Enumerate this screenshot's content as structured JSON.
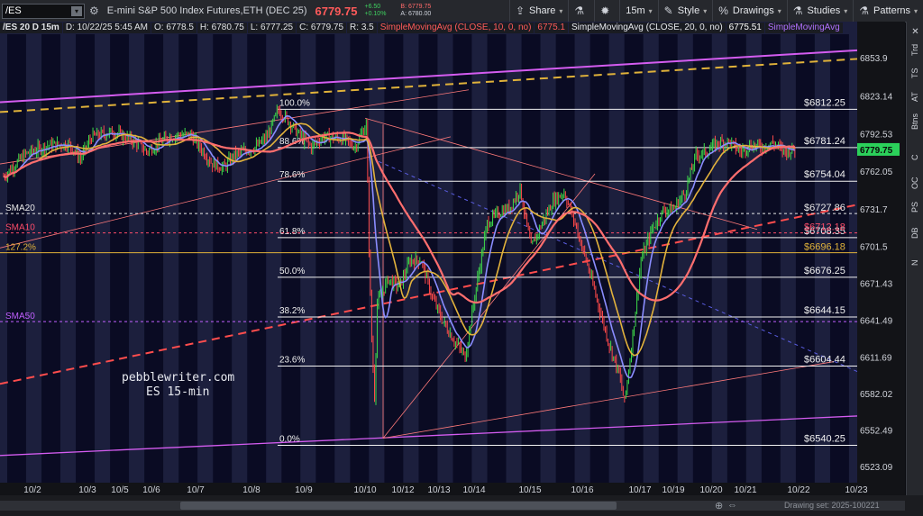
{
  "toolbar": {
    "symbol": "/ES",
    "description": "E-mini S&P 500 Index Futures,ETH (DEC 25)",
    "last_price": "6779.75",
    "change": "+6.50",
    "change_pct": "+0.10%",
    "bid": "B: 6779.75",
    "ask": "A: 6780.00",
    "share_label": "Share",
    "timeframe_label": "15m",
    "style_label": "Style",
    "drawings_label": "Drawings",
    "studies_label": "Studies",
    "patterns_label": "Patterns"
  },
  "header": {
    "title": "/ES 20 D 15m",
    "date": "D: 10/22/25 5:45 AM",
    "open": "O: 6778.5",
    "high": "H: 6780.75",
    "low": "L: 6777.25",
    "close": "C: 6779.75",
    "range": "R: 3.5",
    "sma10_label": "SimpleMovingAvg (CLOSE, 10, 0, no)",
    "sma10_value": "6775.1",
    "sma20_label": "SimpleMovingAvg (CLOSE, 20, 0, no)",
    "sma20_value": "6775.51",
    "sma50_label": "SimpleMovingAvg"
  },
  "sidebar": {
    "items": [
      "Trd",
      "TS",
      "AT",
      "Btns",
      "C",
      "OC",
      "PS",
      "DB",
      "N"
    ]
  },
  "watermark": {
    "line1": "pebblewriter.com",
    "line2": "ES 15-min"
  },
  "footer": {
    "drawing_set": "Drawing set: 2025-100221"
  },
  "chart_data": {
    "type": "candlestick",
    "title": "/ES 20 D 15m",
    "ylim": [
      6510,
      6873
    ],
    "y_ticks": [
      6853.9,
      6823.14,
      6792.53,
      6762.05,
      6731.7,
      6701.5,
      6671.43,
      6641.49,
      6611.69,
      6582.02,
      6552.49,
      6523.09
    ],
    "x_tick_labels": [
      "10/2",
      "10/3",
      "10/5",
      "10/6",
      "10/7",
      "10/8",
      "10/9",
      "10/10",
      "10/12",
      "10/13",
      "10/14",
      "10/15",
      "10/16",
      "10/17",
      "10/19",
      "10/20",
      "10/21",
      "10/22",
      "10/23"
    ],
    "last_price": 6779.75,
    "fib_levels": [
      {
        "label": "100.0%",
        "price": 6812.25,
        "price_label": "$6812.25"
      },
      {
        "label": "88.6%",
        "price": 6781.24,
        "price_label": "$6781.24"
      },
      {
        "label": "78.6%",
        "price": 6754.04,
        "price_label": "$6754.04"
      },
      {
        "label": "61.8%",
        "price": 6708.35,
        "price_label": "$6708.35"
      },
      {
        "label": "50.0%",
        "price": 6676.25,
        "price_label": "$6676.25"
      },
      {
        "label": "38.2%",
        "price": 6644.15,
        "price_label": "$6644.15"
      },
      {
        "label": "23.6%",
        "price": 6604.44,
        "price_label": "$6604.44"
      },
      {
        "label": "0.0%",
        "price": 6540.25,
        "price_label": "$6540.25"
      }
    ],
    "other_levels": [
      {
        "label": "SMA20",
        "price": 6727.86,
        "price_label": "$6727.86",
        "color": "#e8e8e8"
      },
      {
        "label": "SMA10",
        "price": 6712.18,
        "price_label": "$6712.18",
        "color": "#ff4d6a"
      },
      {
        "label": "127.2%",
        "price": 6696.18,
        "price_label": "$6696.18",
        "color": "#e0b23a"
      },
      {
        "label": "SMA50",
        "price": 6640.4,
        "price_label": "",
        "color": "#c060ff"
      }
    ],
    "price_path": [
      [
        0,
        6758
      ],
      [
        4,
        6776
      ],
      [
        8,
        6783
      ],
      [
        12,
        6784
      ],
      [
        14,
        6772
      ],
      [
        16,
        6790
      ],
      [
        20,
        6794
      ],
      [
        24,
        6786
      ],
      [
        26,
        6778
      ],
      [
        30,
        6790
      ],
      [
        34,
        6792
      ],
      [
        38,
        6768
      ],
      [
        40,
        6765
      ],
      [
        42,
        6775
      ],
      [
        46,
        6782
      ],
      [
        48,
        6790
      ],
      [
        50,
        6812
      ],
      [
        52,
        6802
      ],
      [
        54,
        6790
      ],
      [
        56,
        6782
      ],
      [
        58,
        6790
      ],
      [
        62,
        6788
      ],
      [
        64,
        6782
      ],
      [
        66,
        6800
      ],
      [
        66.5,
        6700
      ],
      [
        67,
        6625
      ],
      [
        67.5,
        6580
      ],
      [
        68,
        6655
      ],
      [
        70,
        6675
      ],
      [
        72,
        6668
      ],
      [
        74,
        6690
      ],
      [
        76,
        6690
      ],
      [
        78,
        6660
      ],
      [
        80,
        6640
      ],
      [
        82,
        6625
      ],
      [
        84,
        6612
      ],
      [
        86,
        6668
      ],
      [
        88,
        6720
      ],
      [
        90,
        6728
      ],
      [
        92,
        6732
      ],
      [
        94,
        6748
      ],
      [
        96,
        6700
      ],
      [
        98,
        6720
      ],
      [
        100,
        6738
      ],
      [
        102,
        6745
      ],
      [
        104,
        6720
      ],
      [
        106,
        6690
      ],
      [
        108,
        6658
      ],
      [
        110,
        6625
      ],
      [
        112,
        6598
      ],
      [
        113,
        6575
      ],
      [
        114,
        6610
      ],
      [
        116,
        6690
      ],
      [
        118,
        6715
      ],
      [
        120,
        6730
      ],
      [
        122,
        6732
      ],
      [
        124,
        6745
      ],
      [
        126,
        6775
      ],
      [
        128,
        6778
      ],
      [
        130,
        6785
      ],
      [
        132,
        6786
      ],
      [
        134,
        6778
      ],
      [
        136,
        6783
      ],
      [
        138,
        6782
      ],
      [
        140,
        6785
      ],
      [
        142,
        6778
      ],
      [
        144,
        6780
      ]
    ],
    "x_max": 156,
    "sessions": 25
  },
  "colors": {
    "bg": "#1c1f3d",
    "band_dark": "#07081f",
    "band_light": "#2a2d55",
    "sma10": "#ff6e6e",
    "sma20": "#e2b23c",
    "sma50": "#8a8dff",
    "magenta_line": "#d45cf0",
    "orange_dash": "#e0b23a",
    "red_dash": "#ff4d4d"
  }
}
